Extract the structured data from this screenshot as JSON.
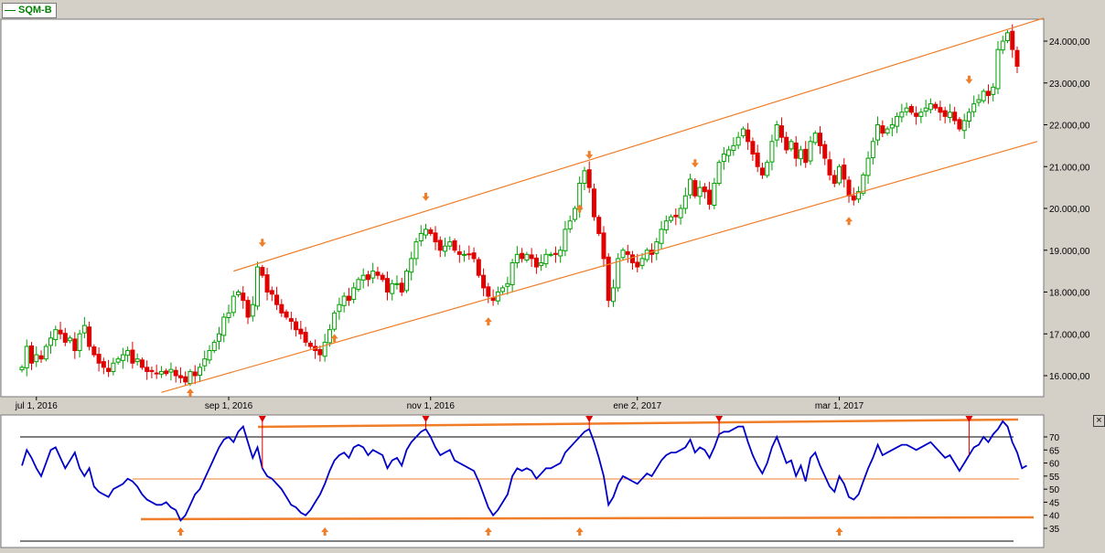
{
  "legend": {
    "label": "SQM-B",
    "color": "#008000"
  },
  "close_label": "×",
  "colors": {
    "up": "#00a000",
    "down": "#e00000",
    "channel": "#f07d28",
    "arrow": "#f07d28",
    "rsi": "#0000c8",
    "marker": "#e00000"
  },
  "chart_data": [
    {
      "type": "candlestick",
      "series_name": "SQM-B",
      "ylim": [
        15600,
        24600
      ],
      "y_ticks": [
        16000,
        17000,
        18000,
        19000,
        20000,
        21000,
        22000,
        23000,
        24000
      ],
      "y_tick_labels": [
        "16.000,00",
        "17.000,00",
        "18.000,00",
        "19.000,00",
        "20.000,00",
        "21.000,00",
        "22.000,00",
        "23.000,00",
        "24.000,00"
      ],
      "x_ticks": [
        {
          "index": 3,
          "label": "jul 1, 2016"
        },
        {
          "index": 43,
          "label": "sep 1, 2016"
        },
        {
          "index": 85,
          "label": "nov 1, 2016"
        },
        {
          "index": 128,
          "label": "ene 2, 2017"
        },
        {
          "index": 170,
          "label": "mar 1, 2017"
        }
      ],
      "count": 206,
      "closes": [
        16200,
        16700,
        16300,
        16500,
        16400,
        16700,
        16900,
        17100,
        17000,
        16800,
        16900,
        16600,
        17000,
        17200,
        16700,
        16500,
        16300,
        16200,
        16100,
        16300,
        16400,
        16500,
        16600,
        16300,
        16400,
        16200,
        16100,
        16100,
        16050,
        16100,
        16050,
        16150,
        16000,
        15950,
        15850,
        16100,
        16000,
        16200,
        16400,
        16600,
        16800,
        17000,
        17400,
        17500,
        17900,
        18000,
        17800,
        17400,
        17700,
        18600,
        18400,
        18000,
        17950,
        17700,
        17500,
        17400,
        17300,
        17100,
        17000,
        16800,
        16700,
        16600,
        16500,
        16800,
        17100,
        17500,
        17700,
        17900,
        17800,
        18100,
        18300,
        18400,
        18300,
        18500,
        18400,
        18300,
        18000,
        18200,
        18200,
        18000,
        18500,
        18800,
        19200,
        19400,
        19500,
        19400,
        19200,
        19000,
        19100,
        19200,
        19000,
        18900,
        18900,
        18900,
        18800,
        18400,
        18100,
        17900,
        17800,
        18000,
        18100,
        18200,
        18700,
        18900,
        18800,
        18900,
        18800,
        18600,
        18700,
        18900,
        18900,
        18900,
        19000,
        19500,
        19700,
        20000,
        20600,
        20900,
        20500,
        19800,
        19400,
        18800,
        17800,
        18100,
        18800,
        19000,
        18900,
        18700,
        18600,
        18800,
        19000,
        18900,
        19200,
        19500,
        19700,
        19800,
        19800,
        20000,
        20300,
        20700,
        20300,
        20500,
        20400,
        20100,
        20600,
        21100,
        21300,
        21400,
        21500,
        21700,
        21900,
        21600,
        21300,
        21000,
        20800,
        21100,
        21600,
        22000,
        21700,
        21400,
        21600,
        21200,
        21400,
        21100,
        21600,
        21800,
        21500,
        21200,
        20800,
        20600,
        21000,
        20700,
        20300,
        20200,
        20400,
        20800,
        21200,
        21600,
        22000,
        21800,
        21900,
        22000,
        22200,
        22300,
        22400,
        22300,
        22200,
        22300,
        22400,
        22500,
        22400,
        22300,
        22200,
        22300,
        22100,
        21900,
        22100,
        22300,
        22500,
        22600,
        22800,
        22700,
        22900,
        23800,
        24000,
        24200,
        23800,
        23400
      ]
    },
    {
      "type": "line",
      "series_name": "",
      "ylim": [
        30,
        77
      ],
      "y_ticks": [
        35,
        40,
        45,
        50,
        55,
        60,
        65,
        70
      ],
      "y_tick_labels": [
        "35",
        "40",
        "45",
        "50",
        "55",
        "60",
        "65",
        "70"
      ],
      "reference_lines": [
        70,
        30
      ],
      "count": 206,
      "values": [
        59,
        65,
        62,
        58,
        55,
        60,
        65,
        66,
        62,
        58,
        61,
        64,
        58,
        55,
        58,
        51,
        49,
        48,
        47,
        50,
        51,
        52,
        54,
        53,
        51,
        48,
        46,
        45,
        44,
        44,
        45,
        43,
        42,
        38,
        40,
        44,
        48,
        50,
        54,
        58,
        62,
        66,
        69,
        70,
        68,
        72,
        74,
        68,
        62,
        66,
        58,
        55,
        54,
        52,
        50,
        47,
        44,
        43,
        41,
        40,
        42,
        45,
        48,
        52,
        57,
        61,
        63,
        64,
        62,
        66,
        67,
        66,
        63,
        65,
        64,
        63,
        58,
        61,
        62,
        59,
        65,
        68,
        70,
        72,
        73,
        70,
        66,
        63,
        64,
        65,
        61,
        60,
        59,
        58,
        57,
        53,
        48,
        43,
        40,
        42,
        45,
        48,
        55,
        58,
        57,
        58,
        57,
        54,
        56,
        58,
        58,
        59,
        60,
        64,
        66,
        68,
        70,
        72,
        73,
        68,
        62,
        55,
        44,
        47,
        52,
        55,
        54,
        53,
        52,
        54,
        56,
        55,
        58,
        61,
        63,
        64,
        64,
        65,
        66,
        69,
        64,
        66,
        65,
        62,
        66,
        71,
        72,
        72,
        73,
        74,
        74,
        68,
        63,
        59,
        56,
        60,
        66,
        70,
        65,
        60,
        61,
        55,
        59,
        53,
        62,
        64,
        59,
        55,
        51,
        49,
        55,
        52,
        47,
        46,
        48,
        53,
        58,
        62,
        67,
        63,
        64,
        65,
        66,
        67,
        67,
        66,
        65,
        66,
        67,
        68,
        66,
        64,
        62,
        63,
        60,
        57,
        60,
        63,
        66,
        67,
        70,
        68,
        71,
        73,
        76,
        74,
        68,
        64,
        58,
        59
      ]
    }
  ]
}
